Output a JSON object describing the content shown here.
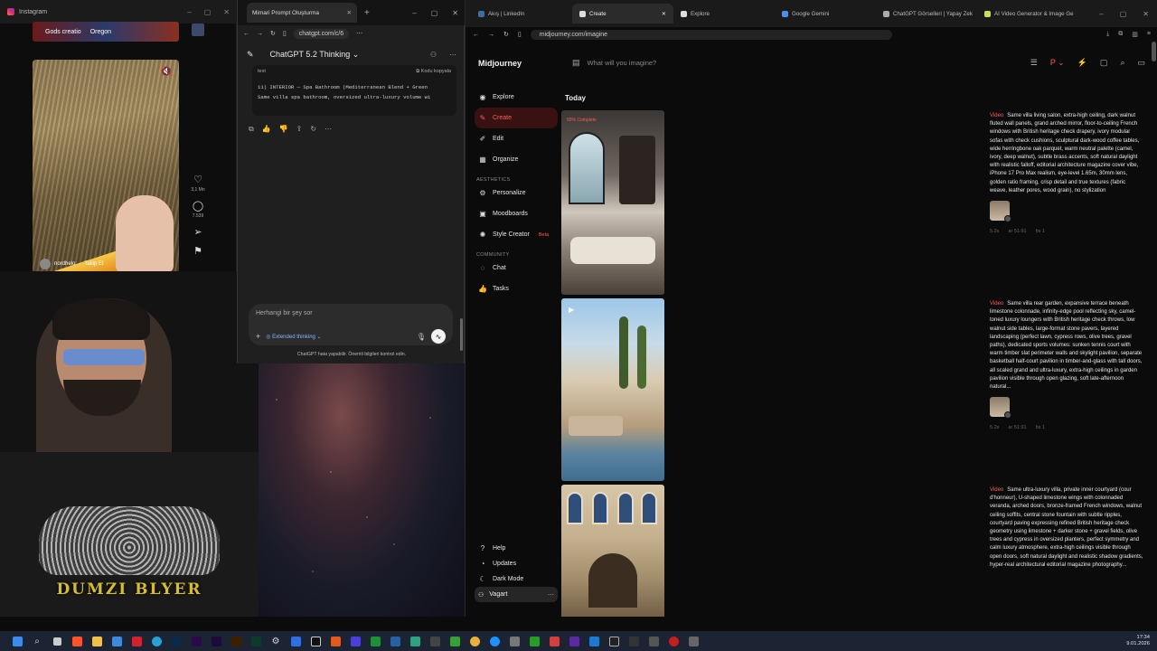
{
  "instagram": {
    "window_title": "Instagram",
    "strip_texts": [
      "Gods creatio",
      "Oregon"
    ],
    "reel": {
      "username": "nordhelo",
      "follow_label": "Takip Et",
      "likes": "3,1 Mn",
      "comments": "7.539"
    }
  },
  "webcam": {
    "overlay_logo_text": "DUMZI BLYER"
  },
  "chatgpt": {
    "tab_title": "Mimari Prompt Oluşturma",
    "url": "chatgpt.com/c/6",
    "model_label": "ChatGPT 5.2 Thinking",
    "code_block": {
      "language": "text",
      "copy_label": "Kodu kopyala",
      "lines": [
        "11) INTERIOR — Spa Bathroom (Mediterranean Blend + Green",
        "Same villa spa bathroom, oversized ultra-luxury volume wi"
      ]
    },
    "composer": {
      "placeholder": "Herhangi bir şey sor",
      "mode_label": "Extended thinking"
    },
    "disclaimer": "ChatGPT hata yapabilir. Önemli bilgileri kontrol edin."
  },
  "midjourney": {
    "browser_tabs": [
      {
        "label": "Akış | LinkedIn",
        "active": false
      },
      {
        "label": "Create",
        "active": true
      },
      {
        "label": "Explore",
        "active": false
      },
      {
        "label": "Google Gemini",
        "active": false
      },
      {
        "label": "ChatGPT Görselleri | Yapay Zek",
        "active": false
      },
      {
        "label": "AI Video Generator & Image Ge",
        "active": false
      }
    ],
    "url": "midjourney.com/imagine",
    "brand": "Midjourney",
    "search_placeholder": "What will you imagine?",
    "menu": {
      "explore": "Explore",
      "create": "Create",
      "edit": "Edit",
      "organize": "Organize",
      "aesthetics_header": "AESTHETICS",
      "personalize": "Personalize",
      "moodboards": "Moodboards",
      "style_creator": "Style Creator",
      "beta": "Beta",
      "community_header": "COMMUNITY",
      "chat": "Chat",
      "tasks": "Tasks"
    },
    "bottom_menu": {
      "help": "Help",
      "updates": "Updates",
      "dark_mode": "Dark Mode",
      "user": "Vagart"
    },
    "today_label": "Today",
    "progress_badge": "55% Complete",
    "jobs": [
      {
        "label": "Video",
        "prompt": "Same villa living salon, extra-high ceiling, dark walnut fluted wall panels, grand arched mirror, floor-to-ceiling French windows with British heritage check drapery, ivory modular sofas with check cushions, sculptural dark-wood coffee tables, wide herringbone oak parquet, warm neutral palette (camel, ivory, deep walnut), subtle brass accents, soft natural daylight with realistic falloff, editorial architecture magazine cover vibe, iPhone 17 Pro Max realism, eye-level 1.65m, 30mm lens, golden ratio framing, crisp detail and true textures (fabric weave, leather pores, wood grain), no stylization",
        "meta": [
          "5.2s",
          "ar 51:91",
          "bs 1"
        ]
      },
      {
        "label": "Video",
        "prompt": "Same villa rear garden, expansive terrace beneath limestone colonnade, infinity-edge pool reflecting sky, camel-toned luxury loungers with British heritage check throws, low walnut side tables, large-format stone pavers, layered landscaping (perfect lawn, cypress rows, olive trees, gravel paths), dedicated sports volumes: sunken tennis court with warm timber slat perimeter walls and skylight pavilion, separate basketball half-court pavilion in timber-and-glass with tall doors, all scaled grand and ultra-luxury, extra-high ceilings in garden pavilion visible through open glazing, soft late-afternoon natural...",
        "meta": [
          "5.2s",
          "ar 51:91",
          "bs 1"
        ]
      },
      {
        "label": "Video",
        "prompt": "Same ultra-luxury villa, private inner courtyard (cour d'honneur), U-shaped limestone wings with colonnaded veranda, arched doors, bronze-framed French windows, walnut ceiling soffits, central stone fountain with subtle ripples, courtyard paving expressing refined British heritage check geometry using limestone + darker stone + gravel fields, olive trees and cypress in oversized planters, perfect symmetry and calm luxury atmosphere, extra-high ceilings visible through open doors, soft natural daylight and realistic shadow gradients, hyper-real architectural editorial magazine photography...",
        "meta": []
      }
    ]
  },
  "taskbar": {
    "time": "17:34",
    "date": "9.01.2026"
  }
}
